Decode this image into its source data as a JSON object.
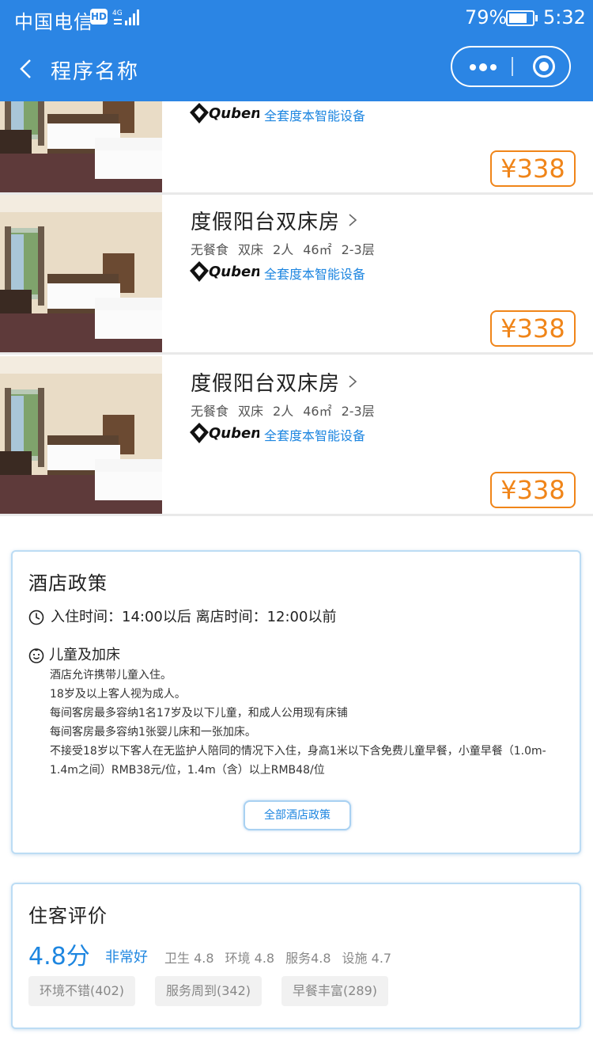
{
  "status_bar": {
    "carrier": "中国电信",
    "hd": "HD",
    "network": "4G",
    "battery_percent": "79%",
    "battery_level": 0.79,
    "time": "5:32"
  },
  "navbar": {
    "title": "程序名称",
    "more_icon": "more-dots-icon",
    "close_icon": "target-circle-icon",
    "back_icon": "chevron-left-icon"
  },
  "rooms": [
    {
      "name": "",
      "specs": [],
      "brand": "Quben",
      "brand_text": "全套度本智能设备",
      "price": "¥338"
    },
    {
      "name": "度假阳台双床房",
      "specs": [
        "无餐食",
        "双床",
        "2人",
        "46㎡",
        "2-3层"
      ],
      "brand": "Quben",
      "brand_text": "全套度本智能设备",
      "price": "¥338"
    },
    {
      "name": "度假阳台双床房",
      "specs": [
        "无餐食",
        "双床",
        "2人",
        "46㎡",
        "2-3层"
      ],
      "brand": "Quben",
      "brand_text": "全套度本智能设备",
      "price": "¥338"
    }
  ],
  "policy": {
    "title": "酒店政策",
    "times": "入住时间：14:00以后  离店时间：12:00以前",
    "kids_title": "儿童及加床",
    "kids_lines": [
      "酒店允许携带儿童入住。",
      "18岁及以上客人视为成人。",
      "每间客房最多容纳1名17岁及以下儿童，和成人公用现有床铺",
      "每间客房最多容纳1张婴儿床和一张加床。",
      "不接受18岁以下客人在无监护人陪同的情况下入住，身高1米以下含免费儿童早餐，小童早餐（1.0m-1.4m之间）RMB38元/位，1.4m（含）以上RMB48/位"
    ],
    "all_button": "全部酒店政策"
  },
  "reviews": {
    "title": "住客评价",
    "score": "4.8分",
    "level": "非常好",
    "subscores": [
      "卫生 4.8",
      "环境 4.8",
      "服务4.8",
      "设施 4.7"
    ],
    "tags": [
      "环境不错(402)",
      "服务周到(342)",
      "早餐丰富(289)"
    ]
  },
  "colors": {
    "primary": "#2b85e4",
    "accent_blue": "#1e86e0",
    "price_orange": "#f08519"
  }
}
